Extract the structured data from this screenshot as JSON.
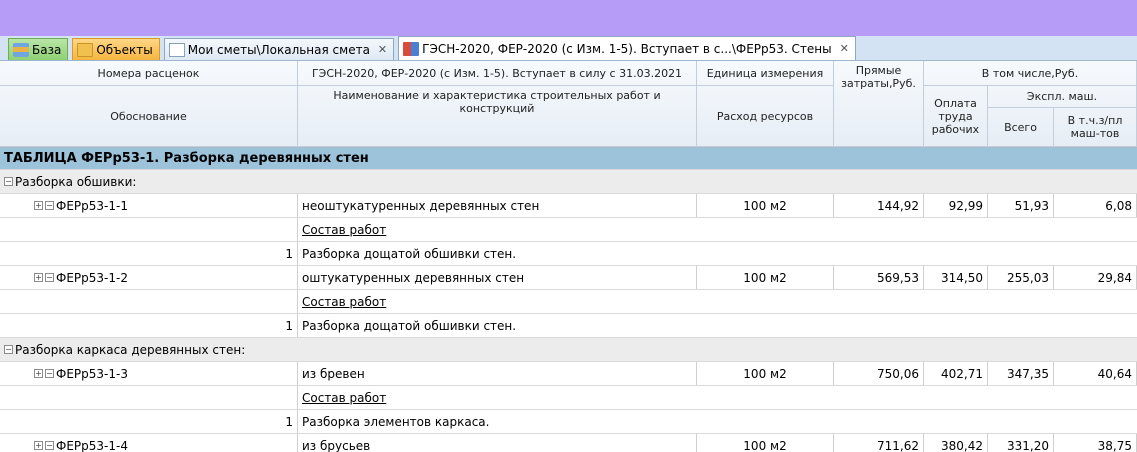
{
  "tabs": [
    {
      "label": "База",
      "icon": "database-icon"
    },
    {
      "label": "Объекты",
      "icon": "folder-icon"
    },
    {
      "label": "Мои сметы\\Локальная смета",
      "icon": "document-icon",
      "close": "✕"
    },
    {
      "label": "ГЭСН-2020, ФЕР-2020 (с Изм. 1-5). Вступает в с...\\ФЕРр53. Стены",
      "icon": "book-icon",
      "close": "✕"
    }
  ],
  "header": {
    "norm_numbers": "Номера расценок",
    "justification": "Обоснование",
    "collection": "ГЭСН-2020, ФЕР-2020 (с Изм. 1-5). Вступает в силу с 31.03.2021",
    "work_name": "Наименование и характеристика строительных работ и конструкций",
    "unit": "Единица измерения",
    "resources": "Расход ресурсов",
    "direct_costs": "Прямые затраты,Руб.",
    "including": "В том числе,Руб.",
    "labor": "Оплата труда рабочих",
    "machines": "Экспл. маш.",
    "total": "Всего",
    "incl_machinists": "В т.ч.з/пл маш-тов"
  },
  "table_title": "ТАБЛИЦА ФЕРр53-1. Разборка деревянных стен",
  "rows": [
    {
      "type": "section",
      "text": "Разборка обшивки:"
    },
    {
      "type": "item",
      "code": "ФЕРр53-1-1",
      "name": "неоштукатуренных деревянных стен",
      "unit": "100 м2",
      "direct": "144,92",
      "labor": "92,99",
      "machines": "51,93",
      "machinists": "6,08"
    },
    {
      "type": "link",
      "text": "Состав работ"
    },
    {
      "type": "step",
      "num": "1",
      "text": "Разборка дощатой обшивки стен."
    },
    {
      "type": "item",
      "code": "ФЕРр53-1-2",
      "name": "оштукатуренных деревянных стен",
      "unit": "100 м2",
      "direct": "569,53",
      "labor": "314,50",
      "machines": "255,03",
      "machinists": "29,84"
    },
    {
      "type": "link",
      "text": "Состав работ"
    },
    {
      "type": "step",
      "num": "1",
      "text": "Разборка дощатой обшивки стен."
    },
    {
      "type": "section",
      "text": "Разборка каркаса деревянных стен:"
    },
    {
      "type": "item",
      "code": "ФЕРр53-1-3",
      "name": "из бревен",
      "unit": "100 м2",
      "direct": "750,06",
      "labor": "402,71",
      "machines": "347,35",
      "machinists": "40,64"
    },
    {
      "type": "link",
      "text": "Состав работ"
    },
    {
      "type": "step",
      "num": "1",
      "text": "Разборка элементов каркаса."
    },
    {
      "type": "item",
      "code": "ФЕРр53-1-4",
      "name": "из брусьев",
      "unit": "100 м2",
      "direct": "711,62",
      "labor": "380,42",
      "machines": "331,20",
      "machinists": "38,75"
    }
  ],
  "glyphs": {
    "expand": "+",
    "collapse": "−"
  }
}
